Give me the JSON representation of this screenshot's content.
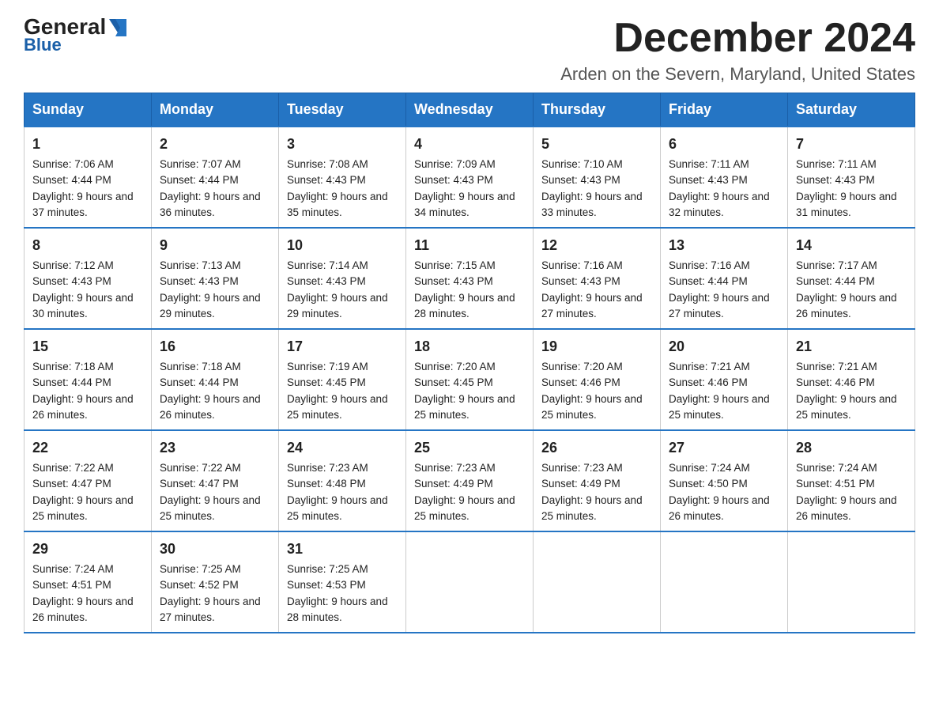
{
  "logo": {
    "general": "General",
    "blue": "Blue"
  },
  "header": {
    "month_year": "December 2024",
    "location": "Arden on the Severn, Maryland, United States"
  },
  "weekdays": [
    "Sunday",
    "Monday",
    "Tuesday",
    "Wednesday",
    "Thursday",
    "Friday",
    "Saturday"
  ],
  "weeks": [
    [
      {
        "day": "1",
        "sunrise": "Sunrise: 7:06 AM",
        "sunset": "Sunset: 4:44 PM",
        "daylight": "Daylight: 9 hours and 37 minutes."
      },
      {
        "day": "2",
        "sunrise": "Sunrise: 7:07 AM",
        "sunset": "Sunset: 4:44 PM",
        "daylight": "Daylight: 9 hours and 36 minutes."
      },
      {
        "day": "3",
        "sunrise": "Sunrise: 7:08 AM",
        "sunset": "Sunset: 4:43 PM",
        "daylight": "Daylight: 9 hours and 35 minutes."
      },
      {
        "day": "4",
        "sunrise": "Sunrise: 7:09 AM",
        "sunset": "Sunset: 4:43 PM",
        "daylight": "Daylight: 9 hours and 34 minutes."
      },
      {
        "day": "5",
        "sunrise": "Sunrise: 7:10 AM",
        "sunset": "Sunset: 4:43 PM",
        "daylight": "Daylight: 9 hours and 33 minutes."
      },
      {
        "day": "6",
        "sunrise": "Sunrise: 7:11 AM",
        "sunset": "Sunset: 4:43 PM",
        "daylight": "Daylight: 9 hours and 32 minutes."
      },
      {
        "day": "7",
        "sunrise": "Sunrise: 7:11 AM",
        "sunset": "Sunset: 4:43 PM",
        "daylight": "Daylight: 9 hours and 31 minutes."
      }
    ],
    [
      {
        "day": "8",
        "sunrise": "Sunrise: 7:12 AM",
        "sunset": "Sunset: 4:43 PM",
        "daylight": "Daylight: 9 hours and 30 minutes."
      },
      {
        "day": "9",
        "sunrise": "Sunrise: 7:13 AM",
        "sunset": "Sunset: 4:43 PM",
        "daylight": "Daylight: 9 hours and 29 minutes."
      },
      {
        "day": "10",
        "sunrise": "Sunrise: 7:14 AM",
        "sunset": "Sunset: 4:43 PM",
        "daylight": "Daylight: 9 hours and 29 minutes."
      },
      {
        "day": "11",
        "sunrise": "Sunrise: 7:15 AM",
        "sunset": "Sunset: 4:43 PM",
        "daylight": "Daylight: 9 hours and 28 minutes."
      },
      {
        "day": "12",
        "sunrise": "Sunrise: 7:16 AM",
        "sunset": "Sunset: 4:43 PM",
        "daylight": "Daylight: 9 hours and 27 minutes."
      },
      {
        "day": "13",
        "sunrise": "Sunrise: 7:16 AM",
        "sunset": "Sunset: 4:44 PM",
        "daylight": "Daylight: 9 hours and 27 minutes."
      },
      {
        "day": "14",
        "sunrise": "Sunrise: 7:17 AM",
        "sunset": "Sunset: 4:44 PM",
        "daylight": "Daylight: 9 hours and 26 minutes."
      }
    ],
    [
      {
        "day": "15",
        "sunrise": "Sunrise: 7:18 AM",
        "sunset": "Sunset: 4:44 PM",
        "daylight": "Daylight: 9 hours and 26 minutes."
      },
      {
        "day": "16",
        "sunrise": "Sunrise: 7:18 AM",
        "sunset": "Sunset: 4:44 PM",
        "daylight": "Daylight: 9 hours and 26 minutes."
      },
      {
        "day": "17",
        "sunrise": "Sunrise: 7:19 AM",
        "sunset": "Sunset: 4:45 PM",
        "daylight": "Daylight: 9 hours and 25 minutes."
      },
      {
        "day": "18",
        "sunrise": "Sunrise: 7:20 AM",
        "sunset": "Sunset: 4:45 PM",
        "daylight": "Daylight: 9 hours and 25 minutes."
      },
      {
        "day": "19",
        "sunrise": "Sunrise: 7:20 AM",
        "sunset": "Sunset: 4:46 PM",
        "daylight": "Daylight: 9 hours and 25 minutes."
      },
      {
        "day": "20",
        "sunrise": "Sunrise: 7:21 AM",
        "sunset": "Sunset: 4:46 PM",
        "daylight": "Daylight: 9 hours and 25 minutes."
      },
      {
        "day": "21",
        "sunrise": "Sunrise: 7:21 AM",
        "sunset": "Sunset: 4:46 PM",
        "daylight": "Daylight: 9 hours and 25 minutes."
      }
    ],
    [
      {
        "day": "22",
        "sunrise": "Sunrise: 7:22 AM",
        "sunset": "Sunset: 4:47 PM",
        "daylight": "Daylight: 9 hours and 25 minutes."
      },
      {
        "day": "23",
        "sunrise": "Sunrise: 7:22 AM",
        "sunset": "Sunset: 4:47 PM",
        "daylight": "Daylight: 9 hours and 25 minutes."
      },
      {
        "day": "24",
        "sunrise": "Sunrise: 7:23 AM",
        "sunset": "Sunset: 4:48 PM",
        "daylight": "Daylight: 9 hours and 25 minutes."
      },
      {
        "day": "25",
        "sunrise": "Sunrise: 7:23 AM",
        "sunset": "Sunset: 4:49 PM",
        "daylight": "Daylight: 9 hours and 25 minutes."
      },
      {
        "day": "26",
        "sunrise": "Sunrise: 7:23 AM",
        "sunset": "Sunset: 4:49 PM",
        "daylight": "Daylight: 9 hours and 25 minutes."
      },
      {
        "day": "27",
        "sunrise": "Sunrise: 7:24 AM",
        "sunset": "Sunset: 4:50 PM",
        "daylight": "Daylight: 9 hours and 26 minutes."
      },
      {
        "day": "28",
        "sunrise": "Sunrise: 7:24 AM",
        "sunset": "Sunset: 4:51 PM",
        "daylight": "Daylight: 9 hours and 26 minutes."
      }
    ],
    [
      {
        "day": "29",
        "sunrise": "Sunrise: 7:24 AM",
        "sunset": "Sunset: 4:51 PM",
        "daylight": "Daylight: 9 hours and 26 minutes."
      },
      {
        "day": "30",
        "sunrise": "Sunrise: 7:25 AM",
        "sunset": "Sunset: 4:52 PM",
        "daylight": "Daylight: 9 hours and 27 minutes."
      },
      {
        "day": "31",
        "sunrise": "Sunrise: 7:25 AM",
        "sunset": "Sunset: 4:53 PM",
        "daylight": "Daylight: 9 hours and 28 minutes."
      },
      null,
      null,
      null,
      null
    ]
  ]
}
